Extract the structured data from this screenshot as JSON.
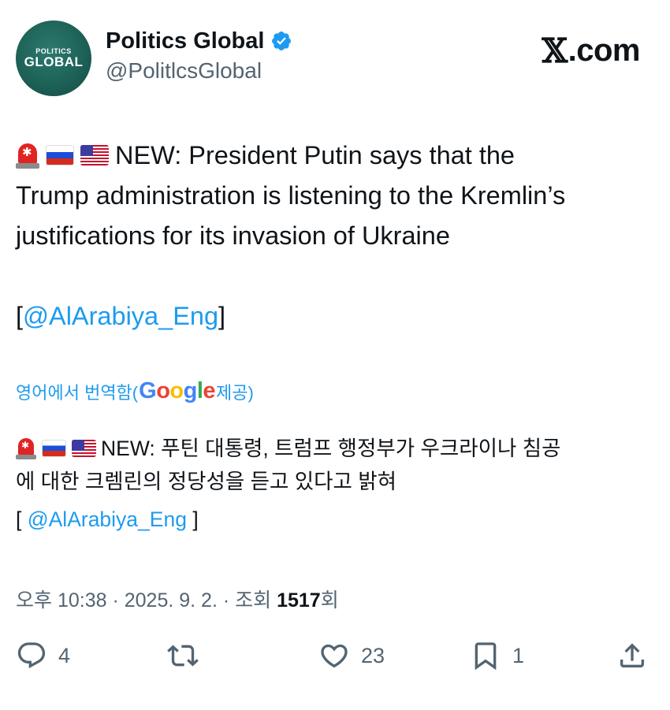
{
  "account": {
    "avatar_small": "POLITICS",
    "avatar_big": "GLOBAL",
    "display_name": "Politics Global",
    "handle": "@PolitlcsGlobal"
  },
  "site": {
    "x_glyph": "𝕏",
    "domain": ".com"
  },
  "tweet": {
    "emojis": [
      "rotating-light-icon",
      "russia-flag-icon",
      "usa-flag-icon"
    ],
    "line1": "NEW: President Putin says that the",
    "line2": "Trump administration is listening to the Kremlin’s",
    "line3": "justifications for its invasion of Ukraine",
    "source_open": "[",
    "source_link": "@AlArabiya_Eng",
    "source_close": "]"
  },
  "translation": {
    "prefix": "영어에서 번역함(",
    "google": [
      "G",
      "o",
      "o",
      "g",
      "l",
      "e"
    ],
    "suffix": " 제공)",
    "line1": "NEW: 푸틴 대통령, 트럼프 행정부가 우크라이나 침공",
    "line2": "에 대한 크렘린의 정당성을 듣고 있다고 밝혀",
    "source_open": "[ ",
    "source_link": "@AlArabiya_Eng",
    "source_close": " ]"
  },
  "meta": {
    "time": "오후 10:38",
    "sep1": " · ",
    "date": "2025. 9. 2.",
    "sep2": " · ",
    "views_label": "조회 ",
    "views_count": "1517",
    "views_suffix": "회"
  },
  "actions": {
    "replies": "4",
    "reposts": "",
    "likes": "23",
    "bookmarks": "1"
  },
  "colors": {
    "link": "#1d9bf0",
    "secondary_text": "#536471",
    "verified": "#1d9bf0",
    "avatar_bg": "#1c5f55"
  }
}
